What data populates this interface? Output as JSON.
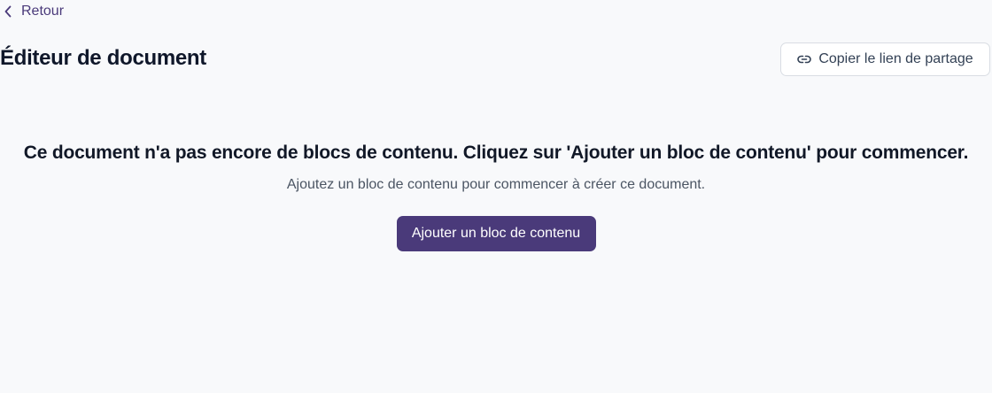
{
  "nav": {
    "back_label": "Retour",
    "back_icon": "chevron-left-icon"
  },
  "header": {
    "title": "Éditeur de document",
    "share_label": "Copier le lien de partage",
    "share_icon": "link-icon"
  },
  "empty_state": {
    "title": "Ce document n'a pas encore de blocs de contenu. Cliquez sur 'Ajouter un bloc de contenu' pour commencer.",
    "subtitle": "Ajoutez un bloc de contenu pour commencer à créer ce document.",
    "button_label": "Ajouter un bloc de contenu"
  },
  "colors": {
    "background": "#f8f9fb",
    "accent": "#4a3a7a",
    "text_primary": "#0f172a",
    "text_secondary": "#4b5563",
    "border": "#d9dde3"
  }
}
